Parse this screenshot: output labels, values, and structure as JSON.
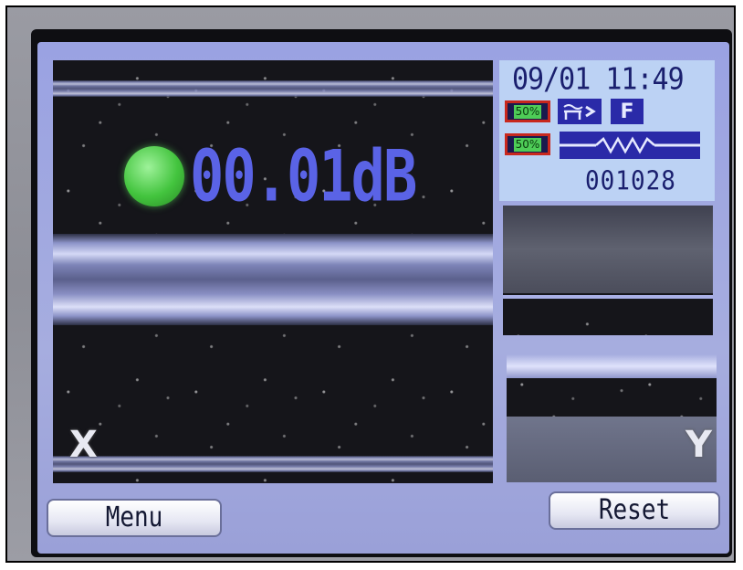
{
  "splice": {
    "loss_value": "00.01dB",
    "status_indicator_color": "#4ccb46"
  },
  "views": {
    "x_label": "X",
    "y_label": "Y"
  },
  "status_panel": {
    "datetime": "09/01 11:49",
    "battery_1": "50%",
    "battery_2": "50%",
    "heater_icon": "heater-arrow-icon",
    "mode_label": "F",
    "arc_icon": "arc-zigzag-icon",
    "counter": "001028"
  },
  "buttons": {
    "menu_label": "Menu",
    "reset_label": "Reset"
  },
  "colors": {
    "screen_bg": "#a3aadf",
    "loss_text": "#5a63e6",
    "status_panel_bg": "#bcd2f4",
    "icon_bg": "#2a2aa8"
  }
}
